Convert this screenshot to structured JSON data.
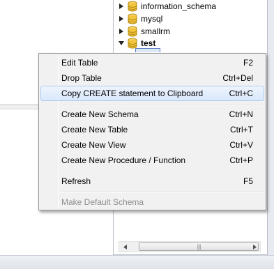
{
  "tree": {
    "items": [
      {
        "label": "information_schema",
        "expanded": false,
        "bold": false
      },
      {
        "label": "mysql",
        "expanded": false,
        "bold": false
      },
      {
        "label": "smallrm",
        "expanded": false,
        "bold": false
      },
      {
        "label": "test",
        "expanded": true,
        "bold": true
      }
    ]
  },
  "context_menu": {
    "items": [
      {
        "label": "Edit Table",
        "shortcut": "F2"
      },
      {
        "label": "Drop Table",
        "shortcut": "Ctrl+Del"
      },
      {
        "label": "Copy CREATE statement to Clipboard",
        "shortcut": "Ctrl+C",
        "state": "hover"
      },
      {
        "label": "Create New Schema",
        "shortcut": "Ctrl+N"
      },
      {
        "label": "Create New Table",
        "shortcut": "Ctrl+T"
      },
      {
        "label": "Create New View",
        "shortcut": "Ctrl+V"
      },
      {
        "label": "Create New Procedure / Function",
        "shortcut": "Ctrl+P"
      },
      {
        "label": "Refresh",
        "shortcut": "F5"
      },
      {
        "label": "Make Default Schema",
        "shortcut": "",
        "state": "disabled"
      }
    ]
  },
  "colors": {
    "db_icon": "#f2c53d",
    "hover_fill": "#dae8fb",
    "disabled_text": "#8d8d8d"
  },
  "icons": {
    "tree_collapsed": "triangle-right-icon",
    "tree_expanded": "triangle-down-icon",
    "schema": "database-icon",
    "scroll_left": "chevron-left-icon",
    "scroll_right": "chevron-right-icon"
  }
}
